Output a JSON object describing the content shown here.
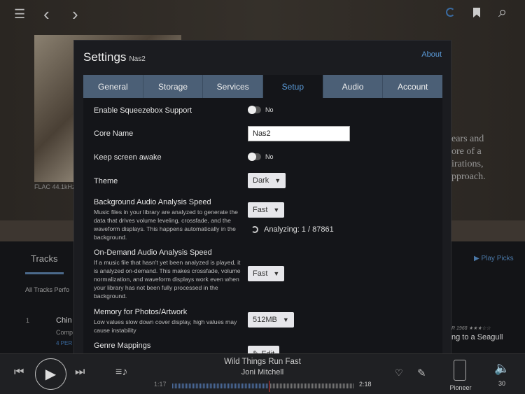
{
  "topbar": {
    "menu": "☰",
    "back": "‹",
    "forward": "›",
    "bookmark": "🔖",
    "search": "⌕"
  },
  "background": {
    "format": "FLAC 44.1kHz",
    "text": [
      "ears and",
      "ore of a",
      "irations,",
      "pproach."
    ],
    "tracks_tab": "Tracks",
    "all_tracks": "All Tracks Perfo",
    "play_picks": "▶ Play Picks",
    "track_num": "1",
    "track_title": "Chin",
    "track_sub": "Comp",
    "track_perf": "4 PER",
    "right_meta": "R 1968 ★★★☆☆",
    "right_title": "ng to a Seagull"
  },
  "settings": {
    "title": "Settings",
    "core": "Nas2",
    "about": "About",
    "tabs": [
      "General",
      "Storage",
      "Services",
      "Setup",
      "Audio",
      "Account"
    ],
    "active_tab": "Setup",
    "squeezebox": {
      "label": "Enable Squeezebox Support",
      "value": "No"
    },
    "core_name": {
      "label": "Core Name",
      "value": "Nas2"
    },
    "screen_awake": {
      "label": "Keep screen awake",
      "value": "No"
    },
    "theme": {
      "label": "Theme",
      "value": "Dark"
    },
    "bg_analysis": {
      "label": "Background Audio Analysis Speed",
      "desc": "Music files in your library are analyzed to generate the data that drives volume leveling, crossfade, and the waveform displays. This happens automatically in the background.",
      "value": "Fast",
      "status": "Analyzing: 1 / 87861"
    },
    "od_analysis": {
      "label": "On-Demand Audio Analysis Speed",
      "desc": "If a music file that hasn't yet been analyzed is played, it is analyzed on-demand. This makes crossfade, volume normalization, and waveform displays work even when your library has not been fully processed in the background.",
      "value": "Fast"
    },
    "memory": {
      "label": "Memory for Photos/Artwork",
      "desc": "Low values slow down cover display, high values may cause instability",
      "value": "512MB"
    },
    "genre": {
      "label": "Genre Mappings",
      "button": "✎ Edit"
    }
  },
  "player": {
    "title": "Wild Things Run Fast",
    "artist": "Joni Mitchell",
    "elapsed": "1:17",
    "total": "2:18",
    "progress": 0.53,
    "zone": "Pioneer",
    "volume": "30"
  }
}
